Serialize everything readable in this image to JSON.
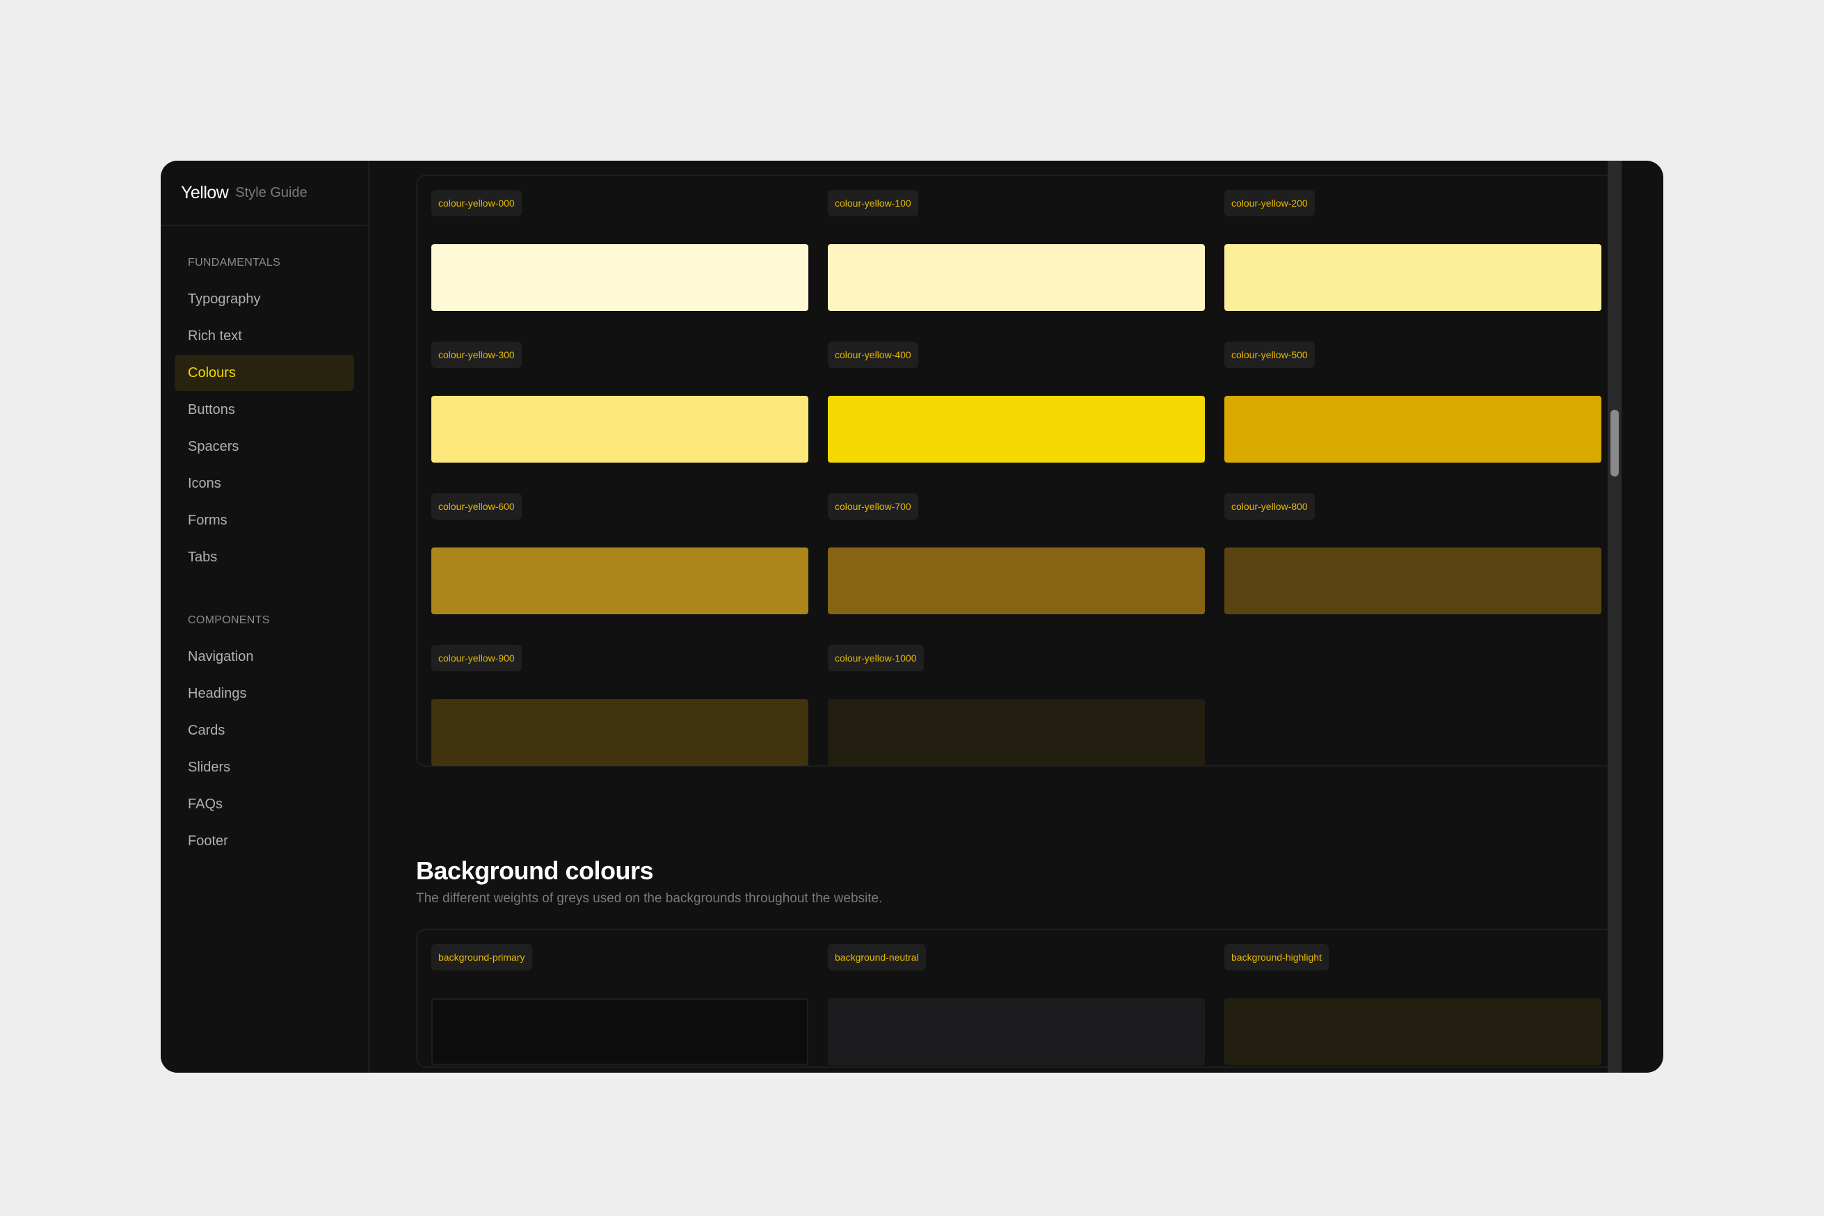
{
  "brand": {
    "name": "Yellow",
    "subtitle": "Style Guide"
  },
  "sidebar": {
    "sections": [
      {
        "heading": "FUNDAMENTALS",
        "items": [
          {
            "label": "Typography",
            "active": false
          },
          {
            "label": "Rich text",
            "active": false
          },
          {
            "label": "Colours",
            "active": true
          },
          {
            "label": "Buttons",
            "active": false
          },
          {
            "label": "Spacers",
            "active": false
          },
          {
            "label": "Icons",
            "active": false
          },
          {
            "label": "Forms",
            "active": false
          },
          {
            "label": "Tabs",
            "active": false
          }
        ]
      },
      {
        "heading": "COMPONENTS",
        "items": [
          {
            "label": "Navigation",
            "active": false
          },
          {
            "label": "Headings",
            "active": false
          },
          {
            "label": "Cards",
            "active": false
          },
          {
            "label": "Sliders",
            "active": false
          },
          {
            "label": "FAQs",
            "active": false
          },
          {
            "label": "Footer",
            "active": false
          }
        ]
      }
    ]
  },
  "yellow_swatches": [
    {
      "label": "colour-yellow-000",
      "color": "#fff9d6"
    },
    {
      "label": "colour-yellow-100",
      "color": "#fff5c0"
    },
    {
      "label": "colour-yellow-200",
      "color": "#fdee9a"
    },
    {
      "label": "colour-yellow-300",
      "color": "#fbe77a"
    },
    {
      "label": "colour-yellow-400",
      "color": "#f5d800"
    },
    {
      "label": "colour-yellow-500",
      "color": "#d9a900"
    },
    {
      "label": "colour-yellow-600",
      "color": "#ad861b"
    },
    {
      "label": "colour-yellow-700",
      "color": "#876413"
    },
    {
      "label": "colour-yellow-800",
      "color": "#5a4512"
    },
    {
      "label": "colour-yellow-900",
      "color": "#41330d"
    },
    {
      "label": "colour-yellow-1000",
      "color": "#231f10"
    }
  ],
  "background_section": {
    "title": "Background colours",
    "description": "The different weights of greys used on the backgrounds throughout the website.",
    "swatches": [
      {
        "label": "background-primary",
        "color": "#0c0c0c",
        "bordered": true
      },
      {
        "label": "background-neutral",
        "color": "#1c1c1e",
        "bordered": false
      },
      {
        "label": "background-highlight",
        "color": "#231f10",
        "bordered": false
      }
    ]
  },
  "chat_button": {
    "icon": "chat-icon",
    "color": "#f5d800"
  }
}
